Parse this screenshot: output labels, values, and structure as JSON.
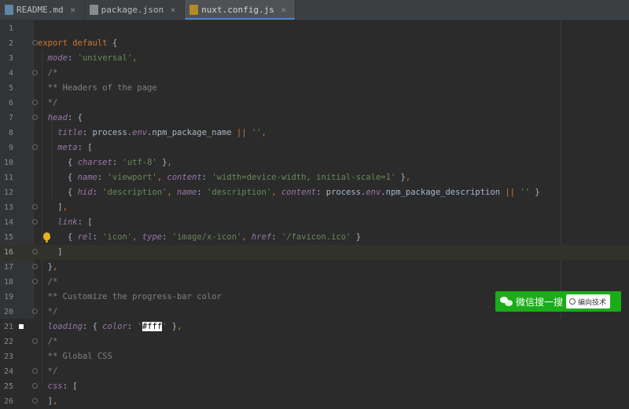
{
  "tabs": [
    {
      "label": "README.md",
      "type": "md",
      "active": false
    },
    {
      "label": "package.json",
      "type": "json",
      "active": false
    },
    {
      "label": "nuxt.config.js",
      "type": "js",
      "active": true
    }
  ],
  "editor": {
    "current_line": 16,
    "lines": [
      {
        "n": "1",
        "tokens": []
      },
      {
        "n": "2",
        "fold": true,
        "tokens": [
          [
            "k",
            "export default "
          ],
          [
            "n",
            "{"
          ]
        ]
      },
      {
        "n": "3",
        "tokens": [
          [
            "n",
            "  "
          ],
          [
            "p",
            "mode"
          ],
          [
            "n",
            ": "
          ],
          [
            "s",
            "'universal'"
          ],
          [
            "o",
            ","
          ]
        ]
      },
      {
        "n": "4",
        "fold": true,
        "tokens": [
          [
            "c",
            "  /*"
          ]
        ]
      },
      {
        "n": "5",
        "tokens": [
          [
            "c",
            "  ** Headers of the page"
          ]
        ]
      },
      {
        "n": "6",
        "fold": true,
        "tokens": [
          [
            "c",
            "  */"
          ]
        ]
      },
      {
        "n": "7",
        "fold": true,
        "tokens": [
          [
            "n",
            "  "
          ],
          [
            "p",
            "head"
          ],
          [
            "n",
            ": {"
          ]
        ]
      },
      {
        "n": "8",
        "tokens": [
          [
            "n",
            "    "
          ],
          [
            "p",
            "title"
          ],
          [
            "n",
            ": process."
          ],
          [
            "p",
            "env"
          ],
          [
            "n",
            ".npm_package_name "
          ],
          [
            "o",
            "||"
          ],
          [
            "n",
            " "
          ],
          [
            "s",
            "''"
          ],
          [
            "o",
            ","
          ]
        ]
      },
      {
        "n": "9",
        "fold": true,
        "tokens": [
          [
            "n",
            "    "
          ],
          [
            "p",
            "meta"
          ],
          [
            "n",
            ": ["
          ]
        ]
      },
      {
        "n": "10",
        "tokens": [
          [
            "n",
            "      { "
          ],
          [
            "p",
            "charset"
          ],
          [
            "n",
            ": "
          ],
          [
            "s",
            "'utf-8'"
          ],
          [
            "n",
            " }"
          ],
          [
            "o",
            ","
          ]
        ]
      },
      {
        "n": "11",
        "tokens": [
          [
            "n",
            "      { "
          ],
          [
            "p",
            "name"
          ],
          [
            "n",
            ": "
          ],
          [
            "s",
            "'viewport'"
          ],
          [
            "o",
            ", "
          ],
          [
            "p",
            "content"
          ],
          [
            "n",
            ": "
          ],
          [
            "s",
            "'width=device-width, initial-scale=1'"
          ],
          [
            "n",
            " }"
          ],
          [
            "o",
            ","
          ]
        ]
      },
      {
        "n": "12",
        "tokens": [
          [
            "n",
            "      { "
          ],
          [
            "p",
            "hid"
          ],
          [
            "n",
            ": "
          ],
          [
            "s",
            "'description'"
          ],
          [
            "o",
            ", "
          ],
          [
            "p",
            "name"
          ],
          [
            "n",
            ": "
          ],
          [
            "s",
            "'description'"
          ],
          [
            "o",
            ", "
          ],
          [
            "p",
            "content"
          ],
          [
            "n",
            ": process."
          ],
          [
            "p",
            "env"
          ],
          [
            "n",
            ".npm_package_description "
          ],
          [
            "o",
            "||"
          ],
          [
            "n",
            " "
          ],
          [
            "s",
            "''"
          ],
          [
            "n",
            " }"
          ]
        ]
      },
      {
        "n": "13",
        "fold": true,
        "tokens": [
          [
            "n",
            "    ]"
          ],
          [
            "o",
            ","
          ]
        ]
      },
      {
        "n": "14",
        "fold": true,
        "tokens": [
          [
            "n",
            "    "
          ],
          [
            "p",
            "link"
          ],
          [
            "n",
            ": ["
          ]
        ]
      },
      {
        "n": "15",
        "bulb": true,
        "tokens": [
          [
            "n",
            "      { "
          ],
          [
            "p",
            "rel"
          ],
          [
            "n",
            ": "
          ],
          [
            "s",
            "'icon'"
          ],
          [
            "o",
            ", "
          ],
          [
            "p",
            "type"
          ],
          [
            "n",
            ": "
          ],
          [
            "s",
            "'image/x-icon'"
          ],
          [
            "o",
            ", "
          ],
          [
            "p",
            "href"
          ],
          [
            "n",
            ": "
          ],
          [
            "s",
            "'/favicon.ico'"
          ],
          [
            "n",
            " }"
          ]
        ]
      },
      {
        "n": "16",
        "fold": true,
        "tokens": [
          [
            "n",
            "    ]"
          ]
        ]
      },
      {
        "n": "17",
        "fold": true,
        "tokens": [
          [
            "n",
            "  }"
          ],
          [
            "o",
            ","
          ]
        ]
      },
      {
        "n": "18",
        "fold": true,
        "tokens": [
          [
            "c",
            "  /*"
          ]
        ]
      },
      {
        "n": "19",
        "tokens": [
          [
            "c",
            "  ** Customize the progress-bar color"
          ]
        ]
      },
      {
        "n": "20",
        "fold": true,
        "tokens": [
          [
            "c",
            "  */"
          ]
        ]
      },
      {
        "n": "21",
        "bookmark": true,
        "tokens": [
          [
            "n",
            "  "
          ],
          [
            "p",
            "loading"
          ],
          [
            "n",
            ": { "
          ],
          [
            "p",
            "color"
          ],
          [
            "n",
            ": "
          ],
          [
            "s",
            "'"
          ],
          [
            "hl",
            "#fff"
          ],
          [
            "s",
            "'"
          ],
          [
            "n",
            " }"
          ],
          [
            "o",
            ","
          ]
        ]
      },
      {
        "n": "22",
        "fold": true,
        "tokens": [
          [
            "c",
            "  /*"
          ]
        ]
      },
      {
        "n": "23",
        "tokens": [
          [
            "c",
            "  ** Global CSS"
          ]
        ]
      },
      {
        "n": "24",
        "fold": true,
        "tokens": [
          [
            "c",
            "  */"
          ]
        ]
      },
      {
        "n": "25",
        "fold": true,
        "tokens": [
          [
            "n",
            "  "
          ],
          [
            "p",
            "css"
          ],
          [
            "n",
            ": ["
          ]
        ]
      },
      {
        "n": "26",
        "fold": true,
        "tokens": [
          [
            "n",
            "  ]"
          ],
          [
            "o",
            ","
          ]
        ]
      }
    ]
  },
  "watermark": {
    "text": "微信搜一搜",
    "search_text": "编向技术"
  }
}
